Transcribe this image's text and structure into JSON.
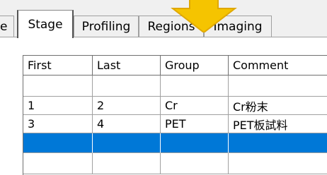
{
  "tabs": [
    {
      "label": "e",
      "active": false
    },
    {
      "label": "Stage",
      "active": true
    },
    {
      "label": "Profiling",
      "active": false
    },
    {
      "label": "Regions",
      "active": false
    },
    {
      "label": "Imaging",
      "active": false
    }
  ],
  "table": {
    "columns": [
      "First",
      "Last",
      "Group",
      "Comment"
    ],
    "rows": [
      [
        "",
        "",
        "",
        ""
      ],
      [
        "1",
        "2",
        "Cr",
        "Cr粉末"
      ],
      [
        "3",
        "4",
        "PET",
        "PET板試料"
      ],
      [
        "",
        "",
        "",
        ""
      ],
      [
        "",
        "",
        "",
        ""
      ]
    ],
    "selected_row": 3
  },
  "colors": {
    "selection": "#0078d7",
    "arrow": "#f5c400"
  },
  "icons": [
    "arrow-down-icon"
  ]
}
